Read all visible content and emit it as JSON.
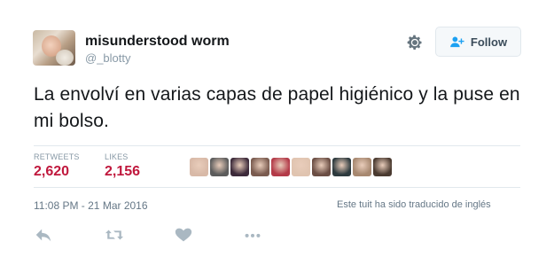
{
  "user": {
    "display_name": "misunderstood worm",
    "handle": "@_blotty"
  },
  "follow_button": {
    "label": "Follow"
  },
  "tweet": {
    "text": "La envolví en varias capas de papel higiénico y la puse en mi bolso."
  },
  "stats": {
    "retweets_label": "RETWEETS",
    "retweets_value": "2,620",
    "likes_label": "LIKES",
    "likes_value": "2,156"
  },
  "liked_by_avatars": [
    {
      "name": "user-1",
      "color": "#d8b9a7"
    },
    {
      "name": "user-2",
      "color": "#5c5c5c"
    },
    {
      "name": "user-3",
      "color": "#3c2a3a"
    },
    {
      "name": "user-4",
      "color": "#7a5b4f"
    },
    {
      "name": "user-5",
      "color": "#b33a48"
    },
    {
      "name": "user-6",
      "color": "#e0c4b0"
    },
    {
      "name": "user-7",
      "color": "#6b4e44"
    },
    {
      "name": "user-8",
      "color": "#2d3a3e"
    },
    {
      "name": "user-9",
      "color": "#a78870"
    },
    {
      "name": "user-10",
      "color": "#4a3a30"
    }
  ],
  "meta": {
    "timestamp": "11:08 PM - 21 Mar 2016",
    "translated_note": "Este tuit ha sido traducido de inglés"
  },
  "actions": {
    "reply_icon": "reply-icon",
    "retweet_icon": "retweet-icon",
    "like_icon": "heart-icon",
    "more_icon": "more-icon"
  },
  "colors": {
    "stat_value": "#c0183d",
    "muted": "#8899a6",
    "divider": "#e1e8ed"
  }
}
